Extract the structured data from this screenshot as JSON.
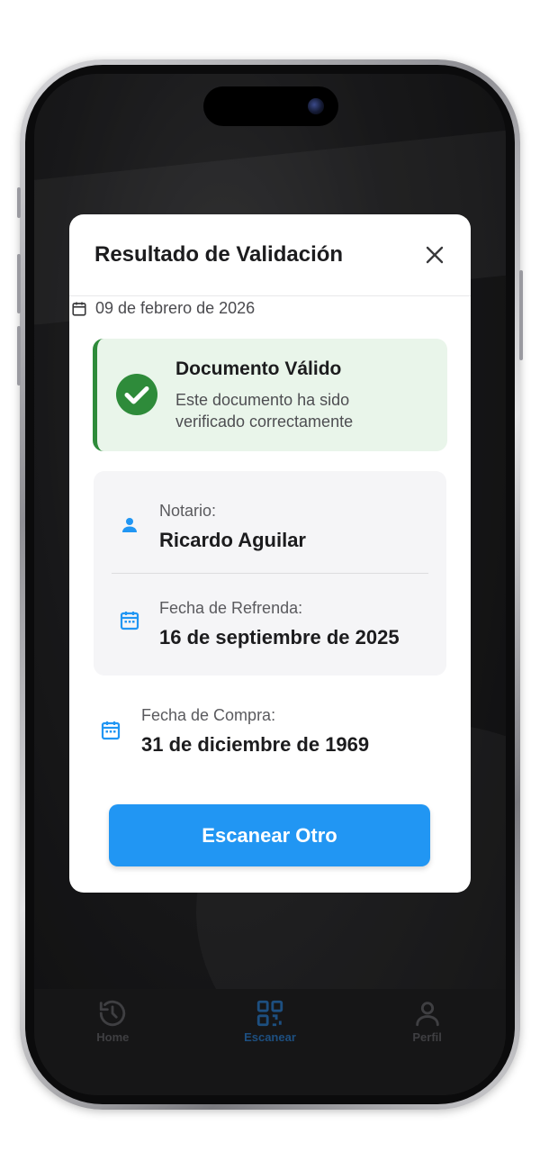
{
  "modal": {
    "title": "Resultado de Validación",
    "date": "09 de febrero de 2026",
    "status": {
      "title": "Documento Válido",
      "message": "Este documento ha sido verificado correctamente",
      "color": "#2e8b3a",
      "background": "#e9f5ea"
    },
    "details": [
      {
        "label": "Notario:",
        "value": "Ricardo Aguilar",
        "icon": "person-icon"
      },
      {
        "label": "Fecha de Refrenda:",
        "value": "16 de septiembre de 2025",
        "icon": "calendar-icon"
      }
    ],
    "purchase": {
      "label": "Fecha de Compra:",
      "value": "31 de diciembre de 1969",
      "icon": "calendar-icon"
    },
    "button_label": "Escanear Otro"
  },
  "tabbar": {
    "items": [
      {
        "label": "Home",
        "icon": "history-icon",
        "active": false
      },
      {
        "label": "Escanear",
        "icon": "qr-code-icon",
        "active": true
      },
      {
        "label": "Perfil",
        "icon": "user-icon",
        "active": false
      }
    ]
  },
  "colors": {
    "accent": "#2196f3",
    "success": "#2e8b3a",
    "icon_blue": "#2196f3"
  }
}
